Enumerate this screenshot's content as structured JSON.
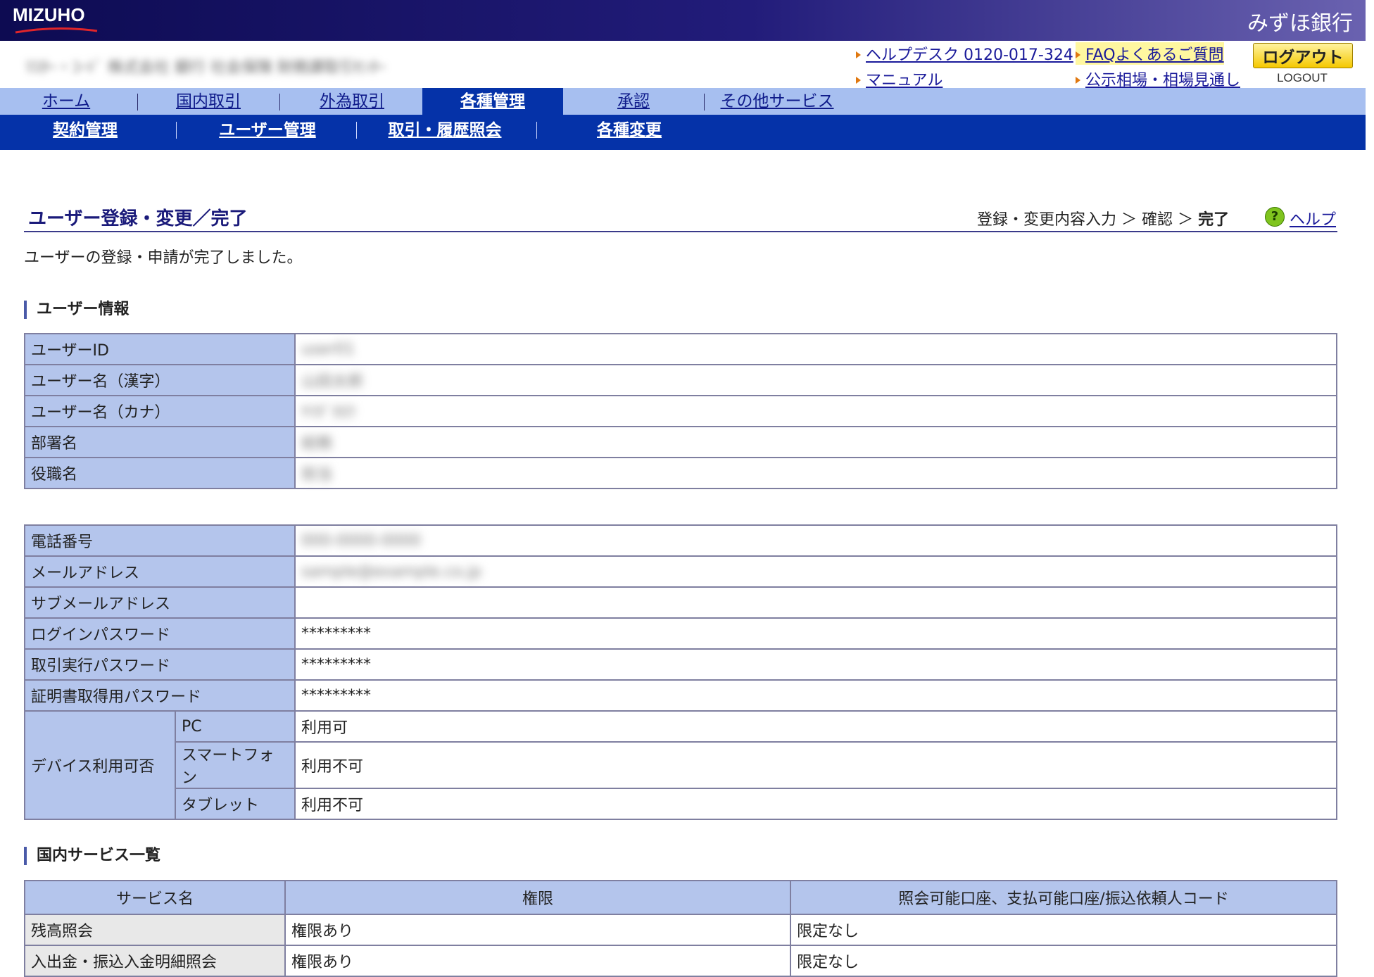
{
  "header": {
    "logo_en": "MIZUHO",
    "logo_jp": "みずほ銀行",
    "company_name": "ﾏｽﾀｰ・ｺｰﾄﾞ 株式会社 銀行 社会保険 財務課取引ｾﾝﾀｰ"
  },
  "util_links": {
    "helpdesk": "ヘルプデスク 0120-017-324",
    "faq": "FAQよくあるご質問",
    "manual": "マニュアル",
    "market": "公示相場・相場見通し",
    "logout_label": "ログアウト",
    "logout_sub": "LOGOUT"
  },
  "nav_primary": [
    {
      "label": "ホーム"
    },
    {
      "label": "国内取引"
    },
    {
      "label": "外為取引"
    },
    {
      "label": "各種管理"
    },
    {
      "label": "承認"
    },
    {
      "label": "その他サービス"
    }
  ],
  "nav_secondary": [
    {
      "label": "契約管理"
    },
    {
      "label": "ユーザー管理"
    },
    {
      "label": "取引・履歴照会"
    },
    {
      "label": "各種変更"
    }
  ],
  "page": {
    "title": "ユーザー登録・変更／完了",
    "steps": {
      "step1": "登録・変更内容入力",
      "sep": "＞",
      "step2": "確認",
      "step3": "完了"
    },
    "help_icon": "?",
    "help_label": "ヘルプ",
    "message": "ユーザーの登録・申請が完了しました。"
  },
  "user_info": {
    "heading": "ユーザー情報",
    "rows": [
      {
        "label": "ユーザーID",
        "value": "user01"
      },
      {
        "label": "ユーザー名（漢字）",
        "value": "山田太郎"
      },
      {
        "label": "ユーザー名（カナ）",
        "value": "ﾔﾏﾀﾞﾀﾛｳ"
      },
      {
        "label": "部署名",
        "value": "総務"
      },
      {
        "label": "役職名",
        "value": "担当"
      }
    ]
  },
  "contact_info": {
    "rows": [
      {
        "label": "電話番号",
        "value": "000-0000-0000"
      },
      {
        "label": "メールアドレス",
        "value": "sample@example.co.jp"
      },
      {
        "label": "サブメールアドレス",
        "value": ""
      },
      {
        "label": "ログインパスワード",
        "value": "*********"
      },
      {
        "label": "取引実行パスワード",
        "value": "*********"
      },
      {
        "label": "証明書取得用パスワード",
        "value": "*********"
      }
    ],
    "device_label": "デバイス利用可否",
    "devices": [
      {
        "name": "PC",
        "value": "利用可"
      },
      {
        "name": "スマートフォン",
        "value": "利用不可"
      },
      {
        "name": "タブレット",
        "value": "利用不可"
      }
    ]
  },
  "domestic_services": {
    "heading": "国内サービス一覧",
    "columns": [
      "サービス名",
      "権限",
      "照会可能口座、支払可能口座/振込依頼人コード"
    ],
    "rows": [
      {
        "service": "残高照会",
        "authority": "権限あり",
        "accounts": "限定なし"
      },
      {
        "service": "入出金・振込入金明細照会",
        "authority": "権限あり",
        "accounts": "限定なし"
      }
    ]
  },
  "colors": {
    "nav_active": "#0532a8",
    "nav_bar": "#a7bff0",
    "table_label_bg": "#b4c5ec"
  }
}
